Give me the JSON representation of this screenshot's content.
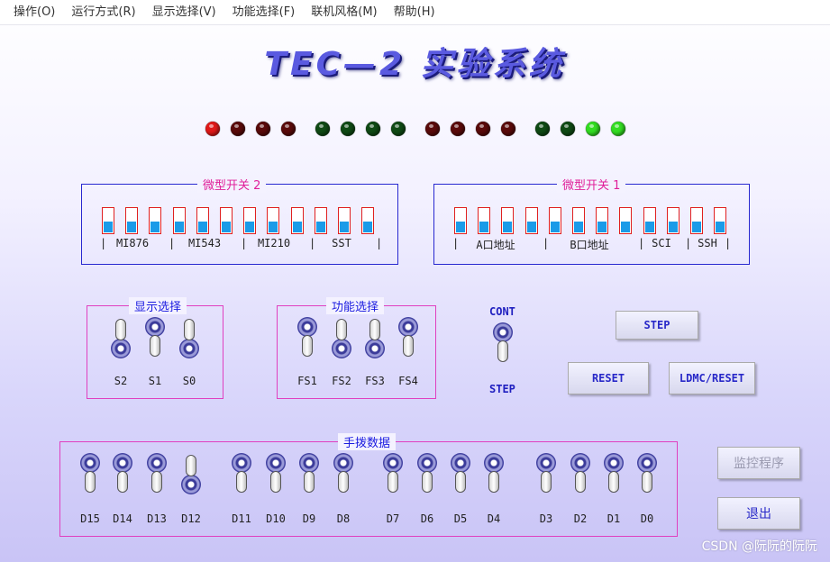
{
  "menu": [
    "操作(O)",
    "运行方式(R)",
    "显示选择(V)",
    "功能选择(F)",
    "联机风格(M)",
    "帮助(H)"
  ],
  "title": "TEC—2 实验系统",
  "colors": {
    "led_bright_red": "#e01818",
    "led_dark_red": "#5a0a0a",
    "led_dark_green": "#0f4a14",
    "led_bright_green": "#33dd22"
  },
  "leds": [
    "led_bright_red",
    "led_dark_red",
    "led_dark_red",
    "led_dark_red",
    "led_dark_green",
    "led_dark_green",
    "led_dark_green",
    "led_dark_green",
    "led_dark_red",
    "led_dark_red",
    "led_dark_red",
    "led_dark_red",
    "led_dark_green",
    "led_dark_green",
    "led_bright_green",
    "led_bright_green"
  ],
  "micro2": {
    "label": "微型开关 2",
    "fields": [
      {
        "sep": "|"
      },
      {
        "name": "MI876"
      },
      {
        "sep": "|"
      },
      {
        "name": "MI543"
      },
      {
        "sep": "|"
      },
      {
        "name": "MI210"
      },
      {
        "sep": "|"
      },
      {
        "name": "SST"
      },
      {
        "sep": "|"
      }
    ]
  },
  "micro1": {
    "label": "微型开关 1",
    "fields": [
      {
        "sep": "|"
      },
      {
        "name": "A口地址"
      },
      {
        "sep": "|"
      },
      {
        "name": "B口地址"
      },
      {
        "sep": "|"
      },
      {
        "name": "SCI"
      },
      {
        "sep": "|"
      },
      {
        "name": "SSH"
      },
      {
        "sep": "|"
      }
    ]
  },
  "display_select": {
    "label": "显示选择",
    "switches": [
      {
        "name": "S2",
        "pos": "up"
      },
      {
        "name": "S1",
        "pos": "down"
      },
      {
        "name": "S0",
        "pos": "up"
      }
    ]
  },
  "function_select": {
    "label": "功能选择",
    "switches": [
      {
        "name": "FS1",
        "pos": "down"
      },
      {
        "name": "FS2",
        "pos": "up"
      },
      {
        "name": "FS3",
        "pos": "up"
      },
      {
        "name": "FS4",
        "pos": "down"
      }
    ]
  },
  "mode": {
    "top": "CONT",
    "bottom": "STEP",
    "pos": "down"
  },
  "buttons": {
    "step": "STEP",
    "reset": "RESET",
    "ldmc": "LDMC/RESET",
    "monitor": "监控程序",
    "exit": "退出"
  },
  "manual_data": {
    "label": "手拨数据",
    "switches": [
      {
        "name": "D15",
        "pos": "down"
      },
      {
        "name": "D14",
        "pos": "down"
      },
      {
        "name": "D13",
        "pos": "down"
      },
      {
        "name": "D12",
        "pos": "up"
      },
      {
        "name": "D11",
        "pos": "down"
      },
      {
        "name": "D10",
        "pos": "down"
      },
      {
        "name": "D9",
        "pos": "down"
      },
      {
        "name": "D8",
        "pos": "down"
      },
      {
        "name": "D7",
        "pos": "down"
      },
      {
        "name": "D6",
        "pos": "down"
      },
      {
        "name": "D5",
        "pos": "down"
      },
      {
        "name": "D4",
        "pos": "down"
      },
      {
        "name": "D3",
        "pos": "down"
      },
      {
        "name": "D2",
        "pos": "down"
      },
      {
        "name": "D1",
        "pos": "down"
      },
      {
        "name": "D0",
        "pos": "down"
      }
    ]
  },
  "watermark": "CSDN @阮阮的阮阮"
}
